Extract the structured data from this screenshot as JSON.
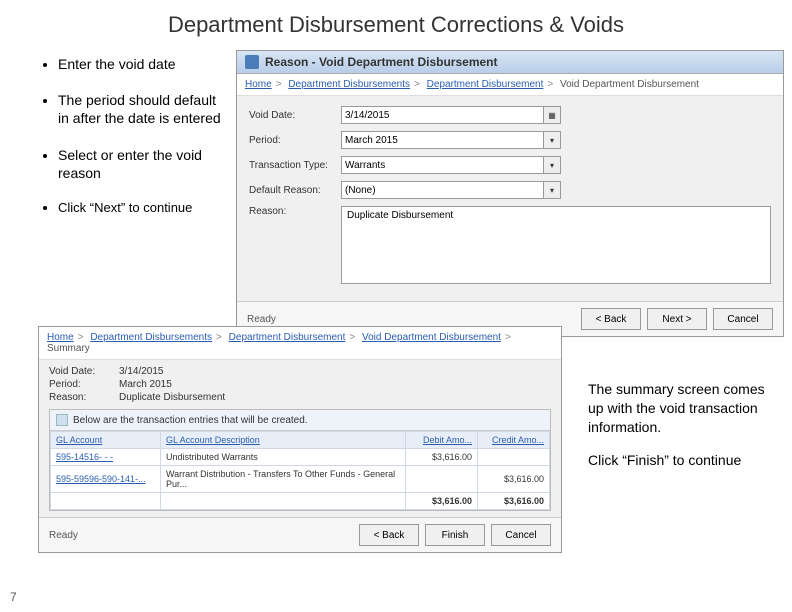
{
  "page_number": "7",
  "title": "Department Disbursement Corrections & Voids",
  "bullets": [
    "Enter the void date",
    "The period should default in after the date is entered",
    "Select or enter the void reason",
    "Click “Next” to continue"
  ],
  "win1": {
    "title": "Reason - Void Department Disbursement",
    "crumbs": [
      "Home",
      "Department Disbursements",
      "Department Disbursement",
      "Void Department Disbursement"
    ],
    "fields": {
      "void_date": {
        "label": "Void Date:",
        "value": "3/14/2015"
      },
      "period": {
        "label": "Period:",
        "value": "March 2015"
      },
      "txn_type": {
        "label": "Transaction Type:",
        "value": "Warrants"
      },
      "def_reason": {
        "label": "Default Reason:",
        "value": "(None)"
      },
      "reason": {
        "label": "Reason:",
        "value": "Duplicate Disbursement"
      }
    },
    "status": "Ready",
    "buttons": {
      "back": "< Back",
      "next": "Next >",
      "cancel": "Cancel"
    }
  },
  "win2": {
    "crumbs": [
      "Home",
      "Department Disbursements",
      "Department Disbursement",
      "Void Department Disbursement",
      "Summary"
    ],
    "summary": {
      "void_date": {
        "label": "Void Date:",
        "value": "3/14/2015"
      },
      "period": {
        "label": "Period:",
        "value": "March 2015"
      },
      "reason": {
        "label": "Reason:",
        "value": "Duplicate Disbursement"
      }
    },
    "grid": {
      "info": "Below are the transaction entries that will be created.",
      "headers": {
        "gl": "GL Account",
        "desc": "GL Account Description",
        "debit": "Debit Amo...",
        "credit": "Credit Amo..."
      },
      "rows": [
        {
          "gl": "595-14516- - -",
          "desc": "Undistributed Warrants",
          "debit": "$3,616.00",
          "credit": ""
        },
        {
          "gl": "595-59596-590-141-...",
          "desc": "Warrant Distribution - Transfers To Other Funds - General Pur...",
          "debit": "",
          "credit": "$3,616.00"
        }
      ],
      "total": {
        "debit": "$3,616.00",
        "credit": "$3,616.00"
      }
    },
    "status": "Ready",
    "buttons": {
      "back": "< Back",
      "finish": "Finish",
      "cancel": "Cancel"
    }
  },
  "notes": {
    "p1": "The summary screen comes up with the void transaction information.",
    "p2": "Click “Finish” to continue"
  }
}
